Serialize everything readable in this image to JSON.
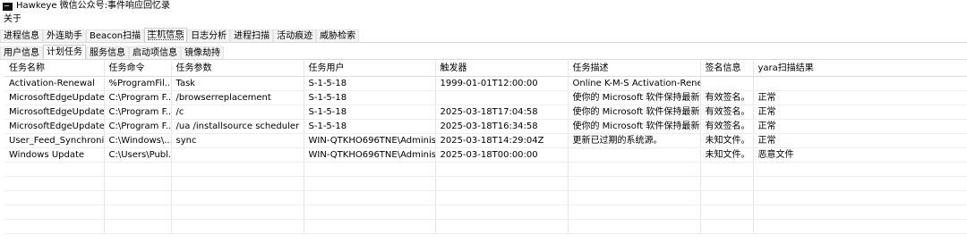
{
  "window": {
    "title": "Hawkeye 微信公众号:事件响应回忆录"
  },
  "menu": {
    "items": [
      "关于"
    ]
  },
  "tabs_primary": [
    "进程信息",
    "外连助手",
    "Beacon扫描",
    "主机信息",
    "日志分析",
    "进程扫描",
    "活动痕迹",
    "威胁检索"
  ],
  "tabs_primary_active": "主机信息",
  "tabs_secondary": [
    "用户信息",
    "计划任务",
    "服务信息",
    "启动项信息",
    "镜像劫持"
  ],
  "tabs_secondary_active": "计划任务",
  "table": {
    "columns": [
      "任务名称",
      "任务命令",
      "任务参数",
      "任务用户",
      "触发器",
      "任务描述",
      "签名信息",
      "yara扫描结果"
    ],
    "rows": [
      [
        "Activation-Renewal",
        "%ProgramFil...",
        "Task",
        "S-1-5-18",
        "1999-01-01T12:00:00",
        "Online K-M-S Activation-Rene...",
        "",
        ""
      ],
      [
        "MicrosoftEdgeUpdate...",
        "C:\\Program F...",
        "/browserreplacement",
        "S-1-5-18",
        "",
        "使你的 Microsoft 软件保持最新...",
        "有效签名。",
        "正常"
      ],
      [
        "MicrosoftEdgeUpdate...",
        "C:\\Program F...",
        "/c",
        "S-1-5-18",
        "2025-03-18T17:04:58",
        "使你的 Microsoft 软件保持最新...",
        "有效签名。",
        "正常"
      ],
      [
        "MicrosoftEdgeUpdate...",
        "C:\\Program F...",
        "/ua /installsource scheduler",
        "S-1-5-18",
        "2025-03-18T16:34:58",
        "使你的 Microsoft 软件保持最新...",
        "有效签名。",
        "正常"
      ],
      [
        "User_Feed_Synchroniz...",
        "C:\\Windows\\...",
        "sync",
        "WIN-QTKHO696TNE\\Administ...",
        "2025-03-18T14:29:04Z",
        "更新已过期的系统源。",
        "未知文件。",
        "正常"
      ],
      [
        "Windows Update",
        "C:\\Users\\Publ...",
        "",
        "WIN-QTKHO696TNE\\Administ...",
        "2025-03-18T00:00:00",
        "",
        "未知文件。",
        "恶意文件"
      ]
    ]
  }
}
